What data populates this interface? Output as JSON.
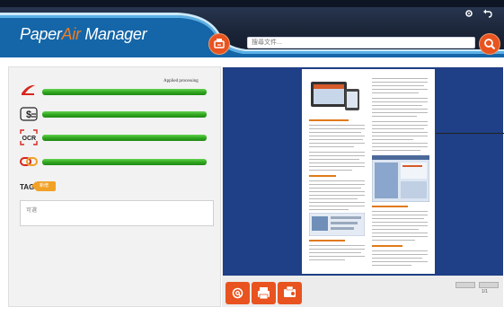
{
  "app": {
    "title_part1": "Paper",
    "title_accent": "Air",
    "title_part2": " Manager"
  },
  "search": {
    "placeholder": "搜尋文件...",
    "value": ""
  },
  "icons": {
    "settings": "gear-icon",
    "back": "back-arrow-icon",
    "scan": "scan-icon",
    "search": "search-icon",
    "pdf": "pdf-icon",
    "money": "dollar-icon",
    "ocr": "ocr-icon",
    "link": "link-icon",
    "tag_add": "tag-add-icon",
    "email": "email-icon",
    "print": "print-icon",
    "fax": "fax-icon"
  },
  "processing": {
    "status_label": "Applied processing",
    "items": [
      {
        "name": "pdf",
        "icon_text": "",
        "progress": 1.0
      },
      {
        "name": "dollar",
        "icon_text": "$",
        "progress": 1.0
      },
      {
        "name": "ocr",
        "icon_text": "OCR",
        "progress": 1.0
      },
      {
        "name": "link",
        "icon_text": "",
        "progress": 1.0
      }
    ]
  },
  "tag": {
    "label": "TAG",
    "add_text": "新增",
    "input_placeholder": "可選"
  },
  "preview": {
    "page_indicator": "1/1"
  },
  "colors": {
    "accent": "#e8531f",
    "header": "#1b2538",
    "preview_bg": "#1f3f86",
    "progress_green": "#2fa41e"
  }
}
